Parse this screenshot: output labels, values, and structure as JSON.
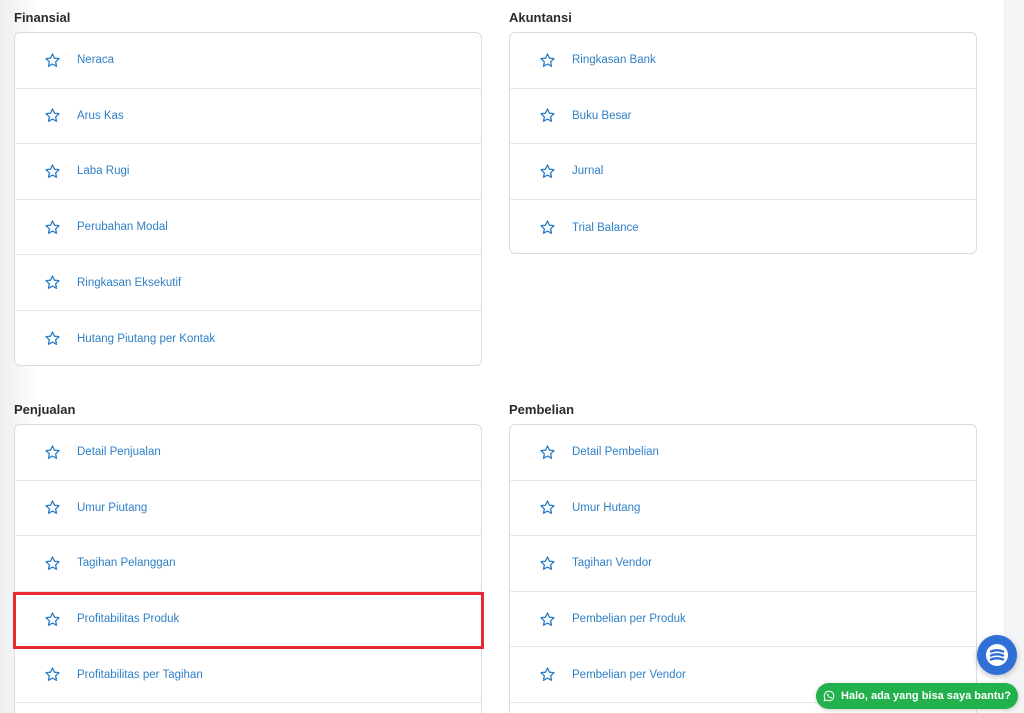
{
  "sections": {
    "finansial": {
      "title": "Finansial",
      "items": [
        "Neraca",
        "Arus Kas",
        "Laba Rugi",
        "Perubahan Modal",
        "Ringkasan Eksekutif",
        "Hutang Piutang per Kontak"
      ]
    },
    "akuntansi": {
      "title": "Akuntansi",
      "items": [
        "Ringkasan Bank",
        "Buku Besar",
        "Jurnal",
        "Trial Balance"
      ]
    },
    "penjualan": {
      "title": "Penjualan",
      "items": [
        "Detail Penjualan",
        "Umur Piutang",
        "Tagihan Pelanggan",
        "Profitabilitas Produk",
        "Profitabilitas per Tagihan"
      ]
    },
    "pembelian": {
      "title": "Pembelian",
      "items": [
        "Detail Pembelian",
        "Umur Hutang",
        "Tagihan Vendor",
        "Pembelian per Produk",
        "Pembelian per Vendor"
      ]
    }
  },
  "icons": {
    "favorite": "star-outline-icon",
    "help": "chat-bubble-icon",
    "whatsapp": "whatsapp-icon"
  },
  "chat_widget": {
    "label": "Halo, ada yang bisa saya bantu?"
  },
  "colors": {
    "link": "#2f80c6",
    "highlight": "#e52a32",
    "whatsapp": "#22b14c",
    "fab": "#2f6fd6"
  }
}
